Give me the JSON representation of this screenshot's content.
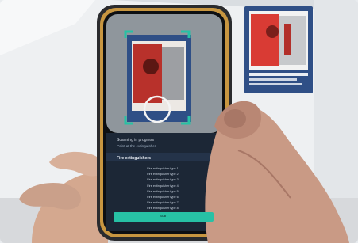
{
  "scene": {
    "description_colors": {
      "wall": "#eef0f2",
      "phone_frame": "#2a2b2e",
      "screen_dark": "#1c2736",
      "accent_teal": "#27c1a5",
      "poster_red": "#d93b34",
      "poster_frame": "#2f4f86"
    }
  },
  "phone": {
    "screen_title": "Scanning in progress",
    "screen_subtitle": "Point at the extinguisher",
    "panel_heading": "Fire extinguishers",
    "list_items": [
      "Fire extinguisher type 1",
      "Fire extinguisher type 2",
      "Fire extinguisher type 3",
      "Fire extinguisher type 4",
      "Fire extinguisher type 5",
      "Fire extinguisher type 6",
      "Fire extinguisher type 7",
      "Fire extinguisher type 8"
    ],
    "cta_label": "Start"
  },
  "icons": {
    "scan_ring": "circle-target-icon"
  }
}
